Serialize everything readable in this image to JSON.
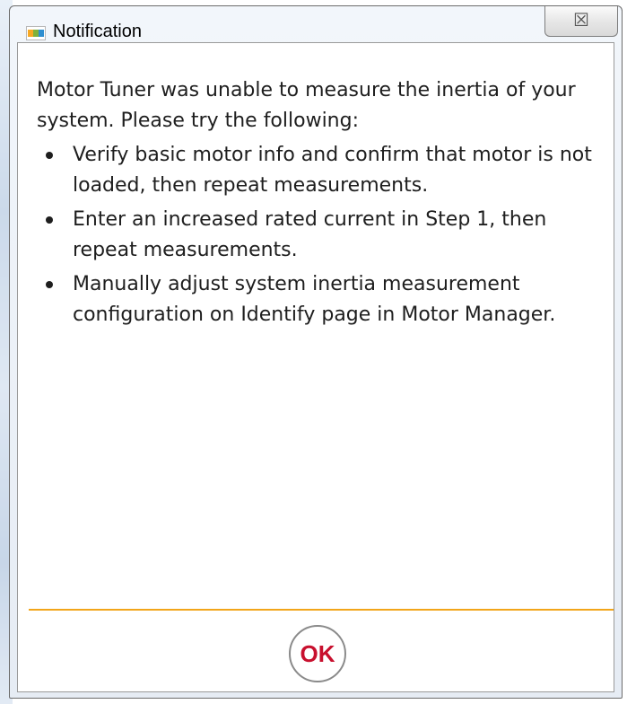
{
  "window": {
    "title": "Notification",
    "app_icon": "nxp-logo-icon",
    "close_glyph": "☒"
  },
  "message": {
    "intro": "Motor Tuner was unable to measure the inertia of your system. Please try the following:",
    "bullets": [
      "Verify basic motor info and confirm that motor is not loaded, then repeat measurements.",
      "Enter an increased rated current in Step 1, then repeat measurements.",
      "Manually adjust system inertia measurement configuration on Identify page in Motor Manager."
    ]
  },
  "footer": {
    "ok_label": "OK"
  },
  "colors": {
    "accent_divider": "#f2a51a",
    "ok_text": "#c8102e"
  }
}
